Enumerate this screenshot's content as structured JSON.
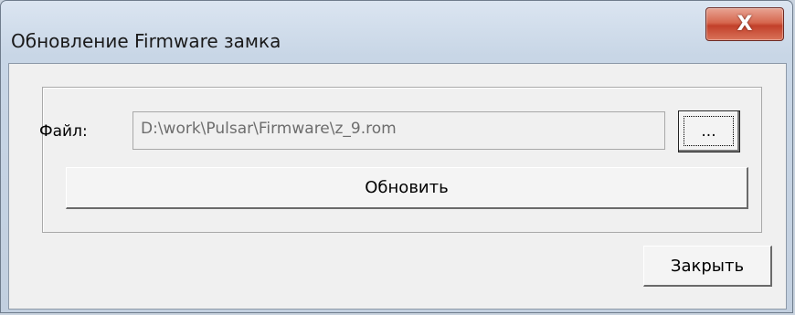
{
  "window": {
    "title": "Обновление Firmware замка",
    "close_glyph": "X"
  },
  "file_row": {
    "label": "Файл:",
    "value": "D:\\work\\Pulsar\\Firmware\\z_9.rom",
    "browse_label": "..."
  },
  "actions": {
    "update_label": "Обновить",
    "close_label": "Закрыть"
  },
  "colors": {
    "close_button": "#c2402a",
    "dialog_background": "#f0f0f0"
  }
}
